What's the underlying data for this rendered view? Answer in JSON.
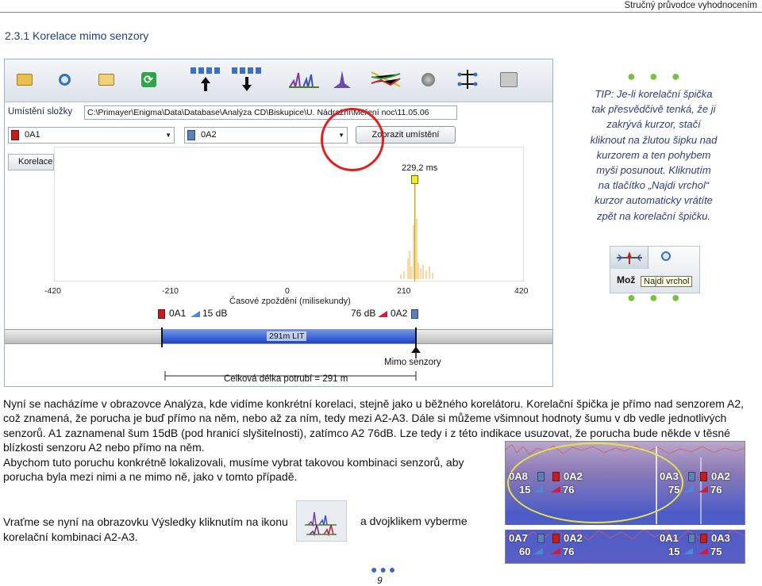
{
  "header": {
    "doc_title": "Stručný průvodce vyhodnocením",
    "section_title": "2.3.1 Korelace mimo senzory"
  },
  "screenshot": {
    "location_label": "Umístění složky",
    "path": "C:\\Primayer\\Enigma\\Data\\Database\\Analýza CD\\Biskupice\\U. Nádražní\\Měření noc\\11.05.06",
    "sensor_left": "0A1",
    "sensor_right": "0A2",
    "show_location_button": "Zobrazit umístění",
    "correlation_tab": "Korelace",
    "cursor_value": "229,2 ms",
    "axis_ticks": [
      "-420",
      "-210",
      "0",
      "210",
      "420"
    ],
    "axis_title": "Časové zpoždění (milisekundy)",
    "left_sensor_label": "0A1",
    "left_noise": "15 dB",
    "right_noise": "76 dB",
    "right_sensor_label": "0A2",
    "pipe_label": "291m LIT",
    "midpoint_label": "Mimo senzory",
    "total_length": "Celková délka potrubí = 291 m",
    "icons": [
      "open-folder-icon",
      "search-icon",
      "export-icon",
      "refresh-icon",
      "sensor-group-up-icon",
      "sensor-group-down-icon",
      "spectrum-multi-icon",
      "spectrum-single-icon",
      "spectrum-colored-icon",
      "speaker-icon",
      "network-icon",
      "print-icon"
    ]
  },
  "tip": {
    "text_lines": [
      "TIP: Je-li korelační špička",
      "tak přesvědčivě tenká, že ji",
      "zakrývá kurzor, stačí",
      "kliknout na žlutou šipku nad",
      "kurzorem a ten pohybem",
      "myši posunout. Kliknutím",
      "na tlačítko „Najdi vrchol“",
      "kurzor automaticky vrátíte",
      "zpět na korelační špičku."
    ],
    "toolbar_text": "Mož",
    "tooltip": "Najdi vrchol"
  },
  "body": {
    "para_lines": [
      "Nyní se nacházíme v obrazovce Analýza, kde vidíme konkrétní korelaci, stejně jako u běžného korelátoru. Korelační špička je přímo nad senzorem A2,",
      "což znamená, že porucha je buď přímo na něm, nebo až za ním, tedy mezi A2-A3. Dále si můžeme všimnout hodnoty šumu v db vedle jednotlivých",
      "senzorů. A1 zaznamenal šum 15dB (pod hranicí slyšitelnosti), zatímco A2 76dB. Lze tedy i z této indikace usuzovat, že porucha bude někde v těsné",
      "blízkosti senzoru A2 nebo přímo na něm.",
      "Abychom tuto poruchu konkrétně lokalizovali, musíme vybrat takovou kombinaci senzorů, aby",
      "porucha byla mezi nimi a ne mimo ně, jako v tomto případě."
    ],
    "return_line1": "Vraťme se nyní na obrazovku Výsledky kliknutím na ikonu",
    "return_line2": "korelační kombinaci A2-A3.",
    "return_right": "a dvojklikem vyberme"
  },
  "panel": {
    "row1": [
      {
        "id": "0A8",
        "db": "15"
      },
      {
        "id": "0A2",
        "db": "76"
      },
      {
        "id": "0A3",
        "db": "75"
      },
      {
        "id": "0A2",
        "db": "76"
      }
    ],
    "row2": [
      {
        "id": "0A7",
        "db": "60"
      },
      {
        "id": "0A2",
        "db": "76"
      },
      {
        "id": "0A1",
        "db": "15"
      },
      {
        "id": "0A3",
        "db": "75"
      }
    ]
  },
  "footer": {
    "page_number": "9"
  }
}
